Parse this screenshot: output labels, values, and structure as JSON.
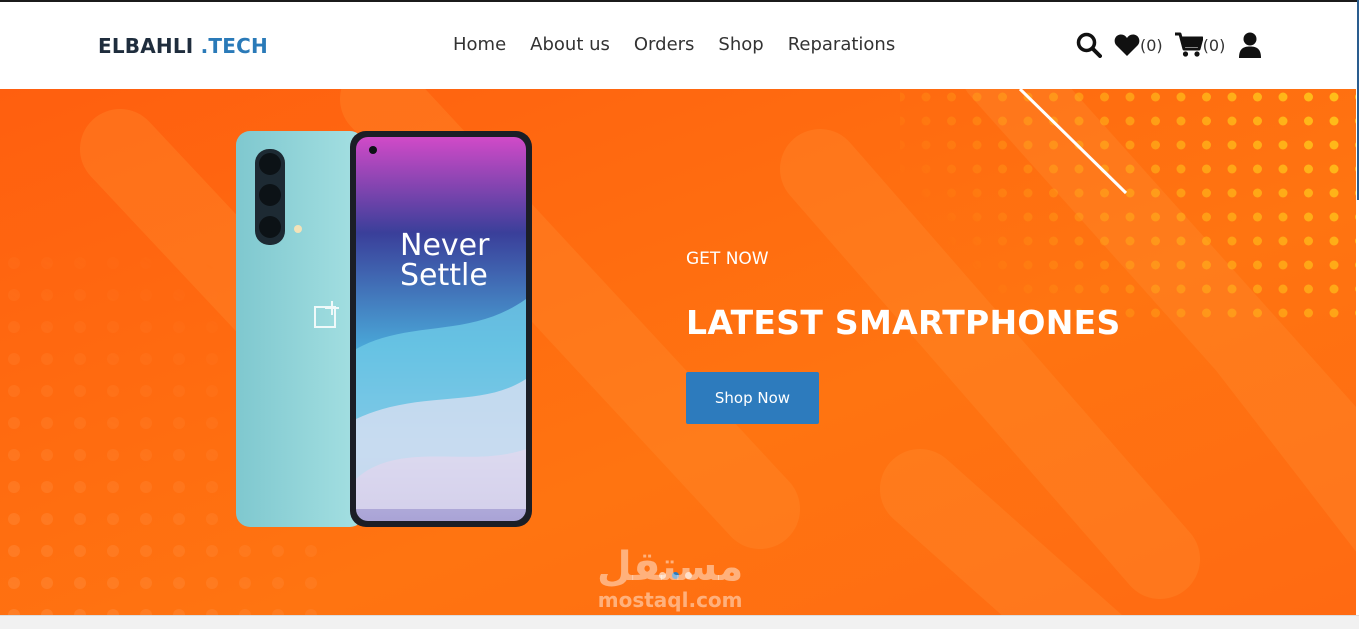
{
  "brand": {
    "part1": "ELBAHLI ",
    "part2": ".TECH"
  },
  "nav": {
    "items": [
      "Home",
      "About us",
      "Orders",
      "Shop",
      "Reparations"
    ]
  },
  "header_icons": {
    "search": "search-icon",
    "wishlist": "heart-icon",
    "wishlist_count": "(0)",
    "cart": "cart-icon",
    "cart_count": "(0)",
    "account": "user-icon"
  },
  "hero": {
    "subtitle": "GET NOW",
    "title": "LATEST SMARTPHONES",
    "button": "Shop Now",
    "phone_screen_text_1": "Never",
    "phone_screen_text_2": "Settle",
    "phone_logo": "1+"
  },
  "watermark": {
    "arabic": "مستقل",
    "latin": "mostaql.com"
  },
  "colors": {
    "hero_bg": "#ff6a12",
    "accent": "#2d7bbd",
    "brand_dark": "#1f2d3d",
    "brand_blue": "#2a7ab8"
  }
}
